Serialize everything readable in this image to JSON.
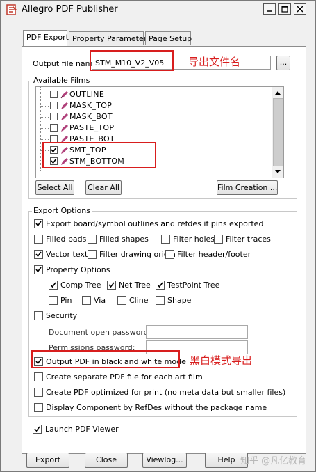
{
  "window": {
    "title": "Allegro PDF Publisher",
    "controls": [
      "minimize-icon",
      "maximize-icon",
      "close-icon"
    ]
  },
  "tabs": [
    {
      "label": "PDF Export",
      "active": true
    },
    {
      "label": "Property Parameters",
      "active": false
    },
    {
      "label": "Page Setup",
      "active": false
    }
  ],
  "output": {
    "label": "Output file name:",
    "value": "STM_M10_V2_V05",
    "browse_label": "..."
  },
  "films": {
    "group_label": "Available Films",
    "items": [
      {
        "name": "OUTLINE",
        "checked": false
      },
      {
        "name": "MASK_TOP",
        "checked": false
      },
      {
        "name": "MASK_BOT",
        "checked": false
      },
      {
        "name": "PASTE_TOP",
        "checked": false
      },
      {
        "name": "PASTE_BOT",
        "checked": false
      },
      {
        "name": "SMT_TOP",
        "checked": true
      },
      {
        "name": "STM_BOTTOM",
        "checked": true
      }
    ],
    "select_all": "Select All",
    "clear_all": "Clear All",
    "film_creation": "Film Creation ..."
  },
  "export_options": {
    "group_label": "Export Options",
    "board_outlines": {
      "label": "Export board/symbol outlines and refdes if pins exported",
      "checked": true
    },
    "filled_pads": {
      "label": "Filled pads",
      "checked": false
    },
    "filled_shapes": {
      "label": "Filled shapes",
      "checked": false
    },
    "filter_holes": {
      "label": "Filter holes",
      "checked": false
    },
    "filter_traces": {
      "label": "Filter traces",
      "checked": false
    },
    "vector_text": {
      "label": "Vector text",
      "checked": true
    },
    "filter_drawing_origin": {
      "label": "Filter drawing origin",
      "checked": false
    },
    "filter_header_footer": {
      "label": "Filter header/footer",
      "checked": false
    },
    "property_options": {
      "label": "Property Options",
      "checked": true
    },
    "comp_tree": {
      "label": "Comp Tree",
      "checked": true
    },
    "net_tree": {
      "label": "Net Tree",
      "checked": true
    },
    "testpoint_tree": {
      "label": "TestPoint Tree",
      "checked": true
    },
    "pin": {
      "label": "Pin",
      "checked": false
    },
    "via": {
      "label": "Via",
      "checked": false
    },
    "cline": {
      "label": "Cline",
      "checked": false
    },
    "shape": {
      "label": "Shape",
      "checked": false
    },
    "security": {
      "label": "Security",
      "checked": false
    },
    "doc_open_password": {
      "label": "Document open password:",
      "value": ""
    },
    "permissions_password": {
      "label": "Permissions password:",
      "value": ""
    },
    "black_white": {
      "label": "Output PDF in black and white mode",
      "checked": true
    },
    "separate_pdf": {
      "label": "Create separate PDF file for each art film",
      "checked": false
    },
    "optimized_print": {
      "label": "Create PDF optimized for print (no meta data but smaller files)",
      "checked": false
    },
    "display_refdes": {
      "label": "Display Component by RefDes without the package name",
      "checked": false
    }
  },
  "launch_viewer": {
    "label": "Launch PDF Viewer",
    "checked": true
  },
  "buttons": {
    "export": "Export",
    "close": "Close",
    "viewlog": "Viewlog...",
    "help": "Help"
  },
  "annotations": {
    "export_filename": "导出文件名",
    "bw_mode": "黑白模式导出",
    "annotation_color": "#d81e1e"
  },
  "watermark": "知乎 @凡亿教育"
}
